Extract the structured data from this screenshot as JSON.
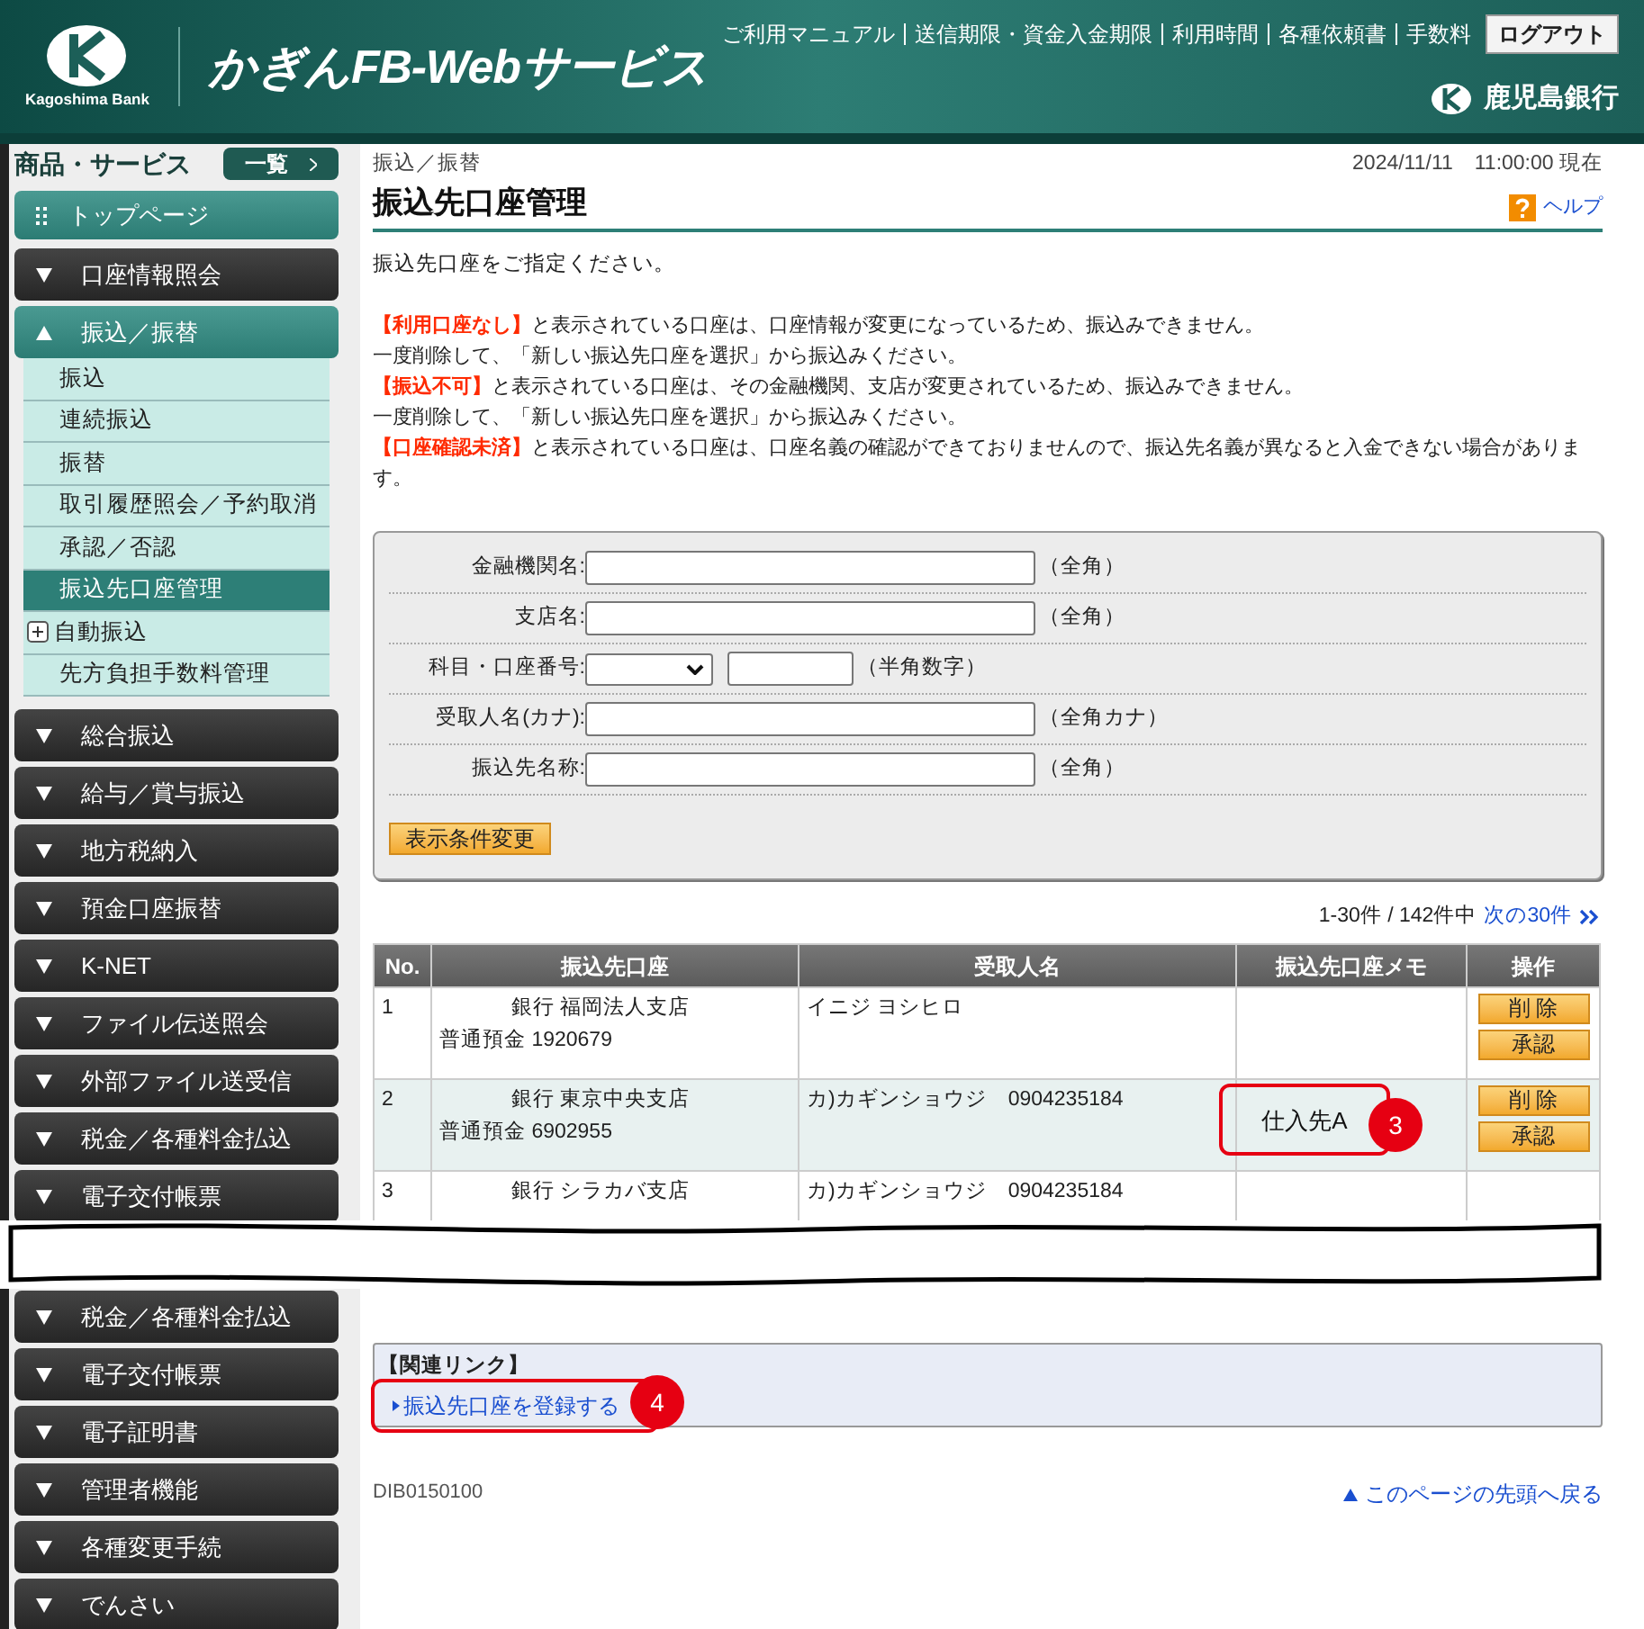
{
  "header": {
    "logo_caption": "Kagoshima Bank",
    "service_name": "かぎんFB-Webサービス",
    "links": [
      "ご利用マニュアル",
      "送信期限・資金入金期限",
      "利用時間",
      "各種依頼書",
      "手数料"
    ],
    "logout": "ログアウト",
    "bank_name": "鹿児島銀行"
  },
  "sidebar": {
    "title": "商品・サービス",
    "list_button": "一覧",
    "items": [
      {
        "kind": "home",
        "label": "トップページ"
      },
      {
        "kind": "section",
        "label": "口座情報照会",
        "expanded": false
      },
      {
        "kind": "section",
        "label": "振込／振替",
        "expanded": true,
        "children": [
          {
            "kind": "link",
            "label": "振込",
            "selected": false
          },
          {
            "kind": "link",
            "label": "連続振込",
            "selected": false
          },
          {
            "kind": "link",
            "label": "振替",
            "selected": false
          },
          {
            "kind": "link",
            "label": "取引履歴照会／予約取消",
            "selected": false
          },
          {
            "kind": "link",
            "label": "承認／否認",
            "selected": false
          },
          {
            "kind": "link",
            "label": "振込先口座管理",
            "selected": true
          },
          {
            "kind": "group",
            "label": "自動振込",
            "selected": false
          },
          {
            "kind": "link",
            "label": "先方負担手数料管理",
            "selected": false
          }
        ]
      },
      {
        "kind": "section",
        "label": "総合振込",
        "expanded": false
      },
      {
        "kind": "section",
        "label": "給与／賞与振込",
        "expanded": false
      },
      {
        "kind": "section",
        "label": "地方税納入",
        "expanded": false
      },
      {
        "kind": "section",
        "label": "預金口座振替",
        "expanded": false
      },
      {
        "kind": "section",
        "label": "K-NET",
        "expanded": false
      },
      {
        "kind": "section",
        "label": "ファイル伝送照会",
        "expanded": false
      },
      {
        "kind": "section",
        "label": "外部ファイル送受信",
        "expanded": false
      },
      {
        "kind": "section",
        "label": "税金／各種料金払込",
        "expanded": false
      },
      {
        "kind": "section",
        "label": "電子交付帳票",
        "expanded": false
      }
    ]
  },
  "main": {
    "breadcrumb": "振込／振替",
    "timestamp": "2024/11/11　11:00:00 現在",
    "title": "振込先口座管理",
    "help": "ヘルプ",
    "intro": "振込先口座をご指定ください。",
    "notices": [
      {
        "tag": "【利用口座なし】",
        "text": "と表示されている口座は、口座情報が変更になっているため、振込みできません。"
      },
      {
        "text": "一度削除して、「新しい振込先口座を選択」から振込みください。"
      },
      {
        "tag": "【振込不可】",
        "text": "と表示されている口座は、その金融機関、支店が変更されているため、振込みできません。"
      },
      {
        "text": "一度削除して、「新しい振込先口座を選択」から振込みください。"
      },
      {
        "tag": "【口座確認未済】",
        "text": "と表示されている口座は、口座名義の確認ができておりませんので、振込先名義が異なると入金できない場合があります。"
      }
    ],
    "filters": [
      {
        "kind": "text",
        "label": "金融機関名:",
        "hint": "（全角）"
      },
      {
        "kind": "text",
        "label": "支店名:",
        "hint": "（全角）"
      },
      {
        "kind": "select_number",
        "label": "科目・口座番号:",
        "hint": "（半角数字）"
      },
      {
        "kind": "text",
        "label": "受取人名(カナ):",
        "hint": "（全角カナ）"
      },
      {
        "kind": "text",
        "label": "振込先名称:",
        "hint": "（全角）"
      }
    ],
    "filter_button": "表示条件変更",
    "pagination": {
      "summary": "1-30件 / 142件中",
      "next": "次の30件"
    },
    "table": {
      "columns": [
        "No.",
        "振込先口座",
        "受取人名",
        "振込先口座メモ",
        "操作"
      ],
      "rows": [
        {
          "no": "1",
          "account": "銀行 福岡法人支店",
          "account_number": "普通預金 1920679",
          "payee": "イニジ ヨシヒロ",
          "actions": [
            "削 除",
            "承認"
          ]
        },
        {
          "no": "2",
          "account": "銀行 東京中央支店",
          "account_number": "普通預金 6902955",
          "payee": "カ)カギンショウジ　0904235184",
          "memo": "仕入先A",
          "callout": "3",
          "actions": [
            "削 除",
            "承認"
          ]
        },
        {
          "no": "3",
          "account": "銀行 シラカバ支店",
          "payee": "カ)カギンショウジ　0904235184"
        }
      ]
    }
  },
  "sidebar_continued": [
    {
      "kind": "section",
      "label": "税金／各種料金払込",
      "expanded": false
    },
    {
      "kind": "section",
      "label": "電子交付帳票",
      "expanded": false
    },
    {
      "kind": "section",
      "label": "電子証明書",
      "expanded": false
    },
    {
      "kind": "section",
      "label": "管理者機能",
      "expanded": false
    },
    {
      "kind": "section",
      "label": "各種変更手続",
      "expanded": false
    },
    {
      "kind": "section",
      "label": "でんさい",
      "expanded": false
    }
  ],
  "related_links": {
    "title": "【関連リンク】",
    "link": "振込先口座を登録する",
    "callout": "4"
  },
  "footer": {
    "screen_id": "DIB0150100",
    "top_link": "このページの先頭へ戻る"
  }
}
